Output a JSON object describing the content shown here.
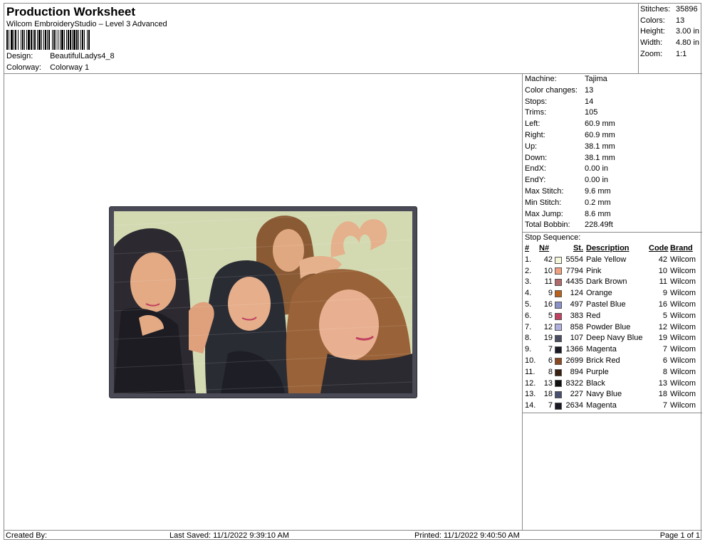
{
  "header": {
    "title": "Production Worksheet",
    "subtitle": "Wilcom EmbroideryStudio – Level 3 Advanced",
    "design_label": "Design:",
    "design_value": "BeautifulLadys4_8",
    "colorway_label": "Colorway:",
    "colorway_value": "Colorway 1"
  },
  "summary": [
    {
      "label": "Stitches:",
      "value": "35896"
    },
    {
      "label": "Colors:",
      "value": "13"
    },
    {
      "label": "Height:",
      "value": "3.00 in"
    },
    {
      "label": "Width:",
      "value": "4.80 in"
    },
    {
      "label": "Zoom:",
      "value": "1:1"
    }
  ],
  "stats": [
    {
      "label": "Machine:",
      "value": "Tajima"
    },
    {
      "label": "Color changes:",
      "value": "13"
    },
    {
      "label": "Stops:",
      "value": "14"
    },
    {
      "label": "Trims:",
      "value": "105"
    },
    {
      "label": "Left:",
      "value": "60.9 mm"
    },
    {
      "label": "Right:",
      "value": "60.9 mm"
    },
    {
      "label": "Up:",
      "value": "38.1 mm"
    },
    {
      "label": "Down:",
      "value": "38.1 mm"
    },
    {
      "label": "EndX:",
      "value": "0.00 in"
    },
    {
      "label": "EndY:",
      "value": "0.00 in"
    },
    {
      "label": "Max Stitch:",
      "value": "9.6 mm"
    },
    {
      "label": "Min Stitch:",
      "value": "0.2 mm"
    },
    {
      "label": "Max Jump:",
      "value": "8.6 mm"
    },
    {
      "label": "Total Bobbin:",
      "value": "228.49ft"
    }
  ],
  "stop_sequence": {
    "title": "Stop Sequence:",
    "columns": {
      "idx": "#",
      "n": "N#",
      "st": "St.",
      "desc": "Description",
      "code": "Code",
      "brand": "Brand"
    },
    "rows": [
      {
        "idx": "1.",
        "n": "42",
        "color": "#f4f6d8",
        "st": "5554",
        "desc": "Pale Yellow",
        "code": "42",
        "brand": "Wilcom"
      },
      {
        "idx": "2.",
        "n": "10",
        "color": "#f0a080",
        "st": "7794",
        "desc": "Pink",
        "code": "10",
        "brand": "Wilcom"
      },
      {
        "idx": "3.",
        "n": "11",
        "color": "#b06a6a",
        "st": "4435",
        "desc": "Dark Brown",
        "code": "11",
        "brand": "Wilcom"
      },
      {
        "idx": "4.",
        "n": "9",
        "color": "#b8601c",
        "st": "124",
        "desc": "Orange",
        "code": "9",
        "brand": "Wilcom"
      },
      {
        "idx": "5.",
        "n": "16",
        "color": "#8a90c8",
        "st": "497",
        "desc": "Pastel Blue",
        "code": "16",
        "brand": "Wilcom"
      },
      {
        "idx": "6.",
        "n": "5",
        "color": "#c04060",
        "st": "383",
        "desc": "Red",
        "code": "5",
        "brand": "Wilcom"
      },
      {
        "idx": "7.",
        "n": "12",
        "color": "#b0b0e0",
        "st": "858",
        "desc": "Powder Blue",
        "code": "12",
        "brand": "Wilcom"
      },
      {
        "idx": "8.",
        "n": "19",
        "color": "#4a4e60",
        "st": "107",
        "desc": "Deep Navy Blue",
        "code": "19",
        "brand": "Wilcom"
      },
      {
        "idx": "9.",
        "n": "7",
        "color": "#1a1a24",
        "st": "1366",
        "desc": "Magenta",
        "code": "7",
        "brand": "Wilcom"
      },
      {
        "idx": "10.",
        "n": "6",
        "color": "#8a4820",
        "st": "2699",
        "desc": "Brick Red",
        "code": "6",
        "brand": "Wilcom"
      },
      {
        "idx": "11.",
        "n": "8",
        "color": "#3a2010",
        "st": "894",
        "desc": "Purple",
        "code": "8",
        "brand": "Wilcom"
      },
      {
        "idx": "12.",
        "n": "13",
        "color": "#101010",
        "st": "8322",
        "desc": "Black",
        "code": "13",
        "brand": "Wilcom"
      },
      {
        "idx": "13.",
        "n": "18",
        "color": "#485070",
        "st": "227",
        "desc": "Navy Blue",
        "code": "18",
        "brand": "Wilcom"
      },
      {
        "idx": "14.",
        "n": "7",
        "color": "#1a1a24",
        "st": "2634",
        "desc": "Magenta",
        "code": "7",
        "brand": "Wilcom"
      }
    ]
  },
  "footer": {
    "created_by": "Created By:",
    "last_saved": "Last Saved: 11/1/2022 9:39:10 AM",
    "printed": "Printed: 11/1/2022 9:40:50 AM",
    "page": "Page 1 of 1"
  }
}
